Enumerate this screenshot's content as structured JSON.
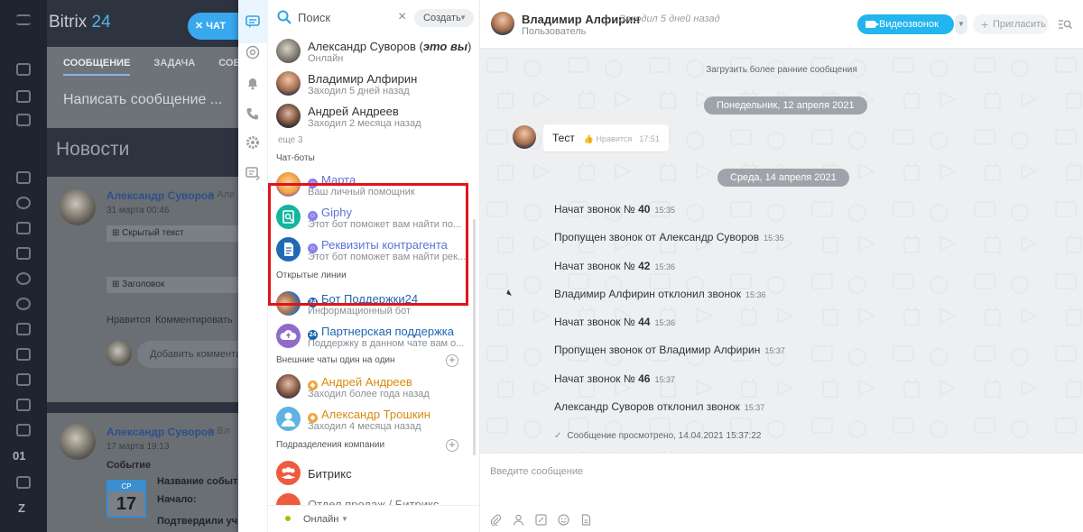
{
  "background": {
    "logo_main": "Bitrix",
    "logo_num": "24",
    "chat_button": "ЧАТ",
    "tabs": [
      "СООБЩЕНИЕ",
      "ЗАДАЧА",
      "СОБЫ"
    ],
    "write_placeholder": "Написать сообщение ...",
    "news_title": "Новости",
    "post1_author": "Александр Суворов",
    "post1_arrow": "> Але",
    "post1_date": "31 марта 00:46",
    "hidden_text": "Скрытый текст",
    "heading_label": "Заголовок",
    "like_label": "Нравится",
    "comment_label": "Комментировать",
    "add_comment": "Добавить комментар",
    "post2_author": "Александр Суворов",
    "post2_arrow": "> Вл",
    "post2_date": "17 марта 19:13",
    "event_label": "Событие",
    "event_name": "Название событ",
    "event_start": "Начало:",
    "event_confirmed": "Подтвердили уч",
    "calendar_month": "СР",
    "calendar_day": "17",
    "rail_text_01": "01",
    "rail_text_z": "Z"
  },
  "search": {
    "placeholder": "Поиск",
    "create_label": "Создать"
  },
  "recent": {
    "users": [
      {
        "name": "Александр Суворов",
        "self_tag": "это вы",
        "status": "Онлайн"
      },
      {
        "name": "Владимир Алфирин",
        "status": "Заходил 5 дней назад"
      },
      {
        "name": "Андрей Андреев",
        "status": "Заходил 2 месяца назад"
      }
    ],
    "more_label": "еще 3",
    "chatbots_section": "Чат-боты",
    "chatbots": [
      {
        "name": "Марта",
        "status": "Ваш личный помощник"
      },
      {
        "name": "Giphy",
        "status": "Этот бот поможет вам найти по..."
      },
      {
        "name": "Реквизиты контрагента",
        "status": "Этот бот поможет вам найти рек..."
      }
    ],
    "openlines_section": "Открытые линии",
    "openlines": [
      {
        "name": "Бот Поддержки24",
        "status": "Информационный бот"
      },
      {
        "name": "Партнерская поддержка",
        "status": "Поддержку в данном чате вам о..."
      }
    ],
    "external_section": "Внешние чаты один на один",
    "external": [
      {
        "name": "Андрей Андреев",
        "status": "Заходил более года назад"
      },
      {
        "name": "Александр Трошкин",
        "status": "Заходил 4 месяца назад"
      }
    ],
    "departments_section": "Подразделения компании",
    "departments": [
      {
        "name": "Битрикс"
      },
      {
        "name": "Отдел продаж / Битрикс"
      }
    ],
    "status_label": "Онлайн"
  },
  "chat": {
    "name": "Владимир Алфирин",
    "last_seen": "Заходил 5 дней назад",
    "role": "Пользователь",
    "video_button": "Видеозвонок HD",
    "invite_button": "Пригласить",
    "load_earlier": "Загрузить более ранние сообщения",
    "date1": "Понедельник, 12 апреля 2021",
    "message": {
      "text": "Тест",
      "like": "Нравится",
      "time": "17:51"
    },
    "date2": "Среда, 14 апреля 2021",
    "events": [
      {
        "text": "Начат звонок № ",
        "num": "40",
        "time": "15:35"
      },
      {
        "text": "Пропущен звонок от Александр Суворов",
        "num": "",
        "time": "15:35"
      },
      {
        "text": "Начат звонок № ",
        "num": "42",
        "time": "15:36"
      },
      {
        "text": "Владимир Алфирин отклонил звонок",
        "num": "",
        "time": "15:36"
      },
      {
        "text": "Начат звонок № ",
        "num": "44",
        "time": "15:36"
      },
      {
        "text": "Пропущен звонок от Владимир Алфирин",
        "num": "",
        "time": "15:37"
      },
      {
        "text": "Начат звонок № ",
        "num": "46",
        "time": "15:37"
      },
      {
        "text": "Александр Суворов отклонил звонок",
        "num": "",
        "time": "15:37"
      }
    ],
    "viewed": "Сообщение просмотрено, 14.04.2021 15:37:22",
    "input_placeholder": "Введите сообщение"
  },
  "colors": {
    "accent": "#22b5ef",
    "bot_name": "#5c73d3",
    "openline_name": "#2066b0",
    "external_name": "#d98b15",
    "highlight": "#e0141b",
    "online": "#9ac50f"
  }
}
